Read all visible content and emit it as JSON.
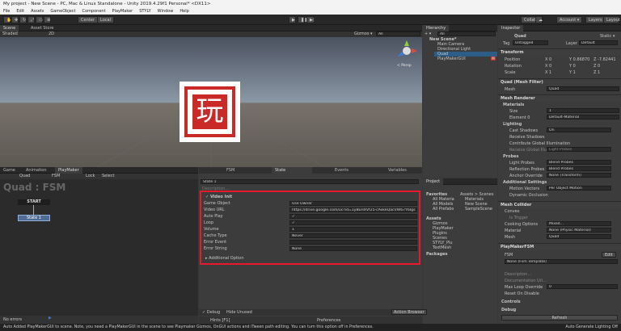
{
  "window": {
    "title": "My project - New Scene - PC, Mac & Linux Standalone - Unity 2019.4.29f1 Personal* <DX11>"
  },
  "menu": [
    "File",
    "Edit",
    "Assets",
    "GameObject",
    "Component",
    "PlayMaker",
    "STYLY",
    "Window",
    "Help"
  ],
  "toolbar": {
    "center": "Center",
    "local": "Local",
    "collab": "Collab ▾",
    "account": "Account ▾",
    "layers": "Layers ▾",
    "layout": "Layout ▾"
  },
  "scene": {
    "tab_scene": "Scene",
    "tab_asset": "Asset Store",
    "shaded": "Shaded",
    "twod": "2D",
    "gizmos": "Gizmos ▾",
    "search": "All",
    "persp": "< Persp",
    "glyph": "玩"
  },
  "hierarchy": {
    "tab": "Hierarchy",
    "add": "+ ▾",
    "search": "All",
    "items": [
      "New Scene*",
      "Main Camera",
      "Directional Light",
      "Quad",
      "PlayMakerGUI"
    ]
  },
  "project": {
    "tab": "Project",
    "fav": "Favorites",
    "fav_items": [
      "All Materia",
      "All Models",
      "All Prefabs"
    ],
    "assets": "Assets",
    "asset_items": [
      "Gizmos",
      "PlayMaker",
      "Plugins",
      "Scenes",
      "STYLY_Plu",
      "TextMesh"
    ],
    "packages": "Packages",
    "breadcrumb": "Assets > Scenes",
    "files": [
      "Materials",
      "New Scene",
      "SampleScene"
    ]
  },
  "playmaker": {
    "tabs": [
      "Game",
      "Animation",
      "PlayMaker"
    ],
    "object": "Quad",
    "fsm": "FSM",
    "lock": "Lock",
    "select": "Select",
    "title": "Quad : FSM",
    "start": "START",
    "state": "State 1",
    "bottom_left": "No errors",
    "debug": "Debug",
    "hints": "Hints [F1]",
    "preferences": "Preferences",
    "hide_unused": "Hide Unused",
    "action_browser": "Action Browser"
  },
  "fsm_panel": {
    "tabs": [
      "FSM",
      "State",
      "Events",
      "Variables"
    ],
    "state_name": "State 1",
    "description": "Description...",
    "action": "Video Init",
    "rows": [
      [
        "Game Object",
        "Use Owner"
      ],
      [
        "Video URL",
        "https://drive.google.com/uc?id=1y8EHXVf25-cAvkeQacVW67Y6Igs"
      ],
      [
        "Auto Play",
        "✓"
      ],
      [
        "Loop",
        "✓"
      ],
      [
        "Volume",
        "1"
      ],
      [
        "Cache Type",
        "Never"
      ],
      [
        "Error Event",
        ""
      ],
      [
        "Error String",
        "None"
      ]
    ],
    "additional": "Additional Option"
  },
  "inspector": {
    "tab": "Inspector",
    "object": "Quad",
    "static": "Static ▾",
    "tag": "Untagged",
    "layer": "Default",
    "transform": {
      "title": "Transform",
      "position": [
        "0",
        "0.86870",
        "-7.82441"
      ],
      "rotation": [
        "0",
        "0",
        "0"
      ],
      "scale": [
        "1",
        "1",
        "1"
      ]
    },
    "meshfilter": {
      "title": "Quad (Mesh Filter)",
      "mesh": "Quad"
    },
    "renderer": {
      "title": "Mesh Renderer",
      "materials": "Materials",
      "size": "1",
      "element": "Default-Material",
      "lighting": "Lighting",
      "cast": "On",
      "receive": "Receive Shadows",
      "contribute": "Contribute Global Illumination",
      "receive_gi": "Light Probes",
      "probes": "Probes",
      "light_probes": "Blend Probes",
      "reflection": "Blend Probes",
      "anchor": "None (Transform)",
      "additional": "Additional Settings",
      "motion": "Per Object Motion",
      "dynamic": "Dynamic Occlusion"
    },
    "collider": {
      "title": "Mesh Collider",
      "convex": "Convex",
      "trigger": "Is Trigger",
      "cooking": "Mixed...",
      "material": "None (Physic Material)",
      "mesh": "Quad"
    },
    "pmfsm": {
      "title": "PlayMakerFSM",
      "fsm": "FSM",
      "edit": "Edit",
      "template": "None (Fsm Template)",
      "description": "Description...",
      "doc": "Documentation Url...",
      "max_loop": "0",
      "reset": "Reset On Disable",
      "controls": "Controls",
      "debug": "Debug",
      "refresh": "Refresh"
    }
  },
  "status": {
    "message": "Auto Added PlayMakerGUI to scene. Note, you need a PlayMakerGUI in the scene to see Playmaker Gizmos, OnGUI actions and iTween path editing. You can turn this option off in Preferences.",
    "right": "Auto Generate Lighting Off"
  },
  "colors": {
    "accent_red": "#e8192c",
    "play_blue": "#3d7bd9"
  }
}
